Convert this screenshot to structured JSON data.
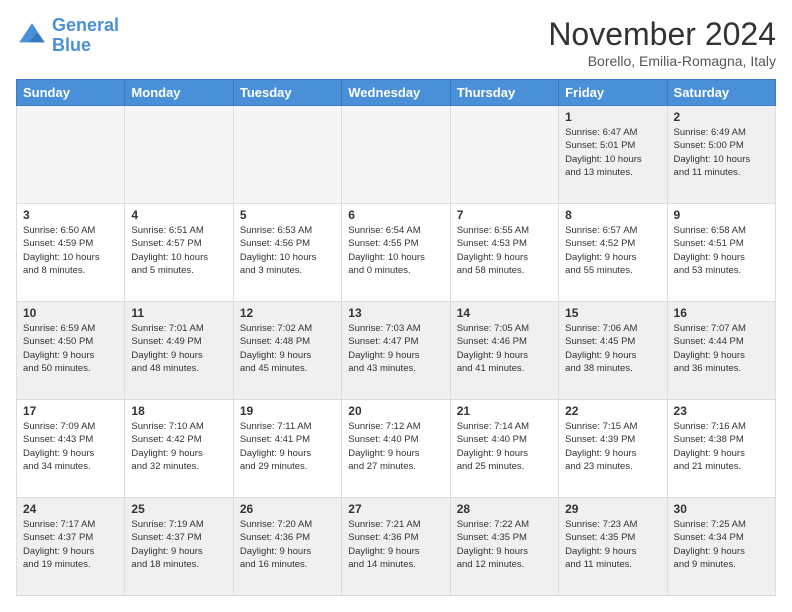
{
  "header": {
    "logo_line1": "General",
    "logo_line2": "Blue",
    "month": "November 2024",
    "location": "Borello, Emilia-Romagna, Italy"
  },
  "weekdays": [
    "Sunday",
    "Monday",
    "Tuesday",
    "Wednesday",
    "Thursday",
    "Friday",
    "Saturday"
  ],
  "weeks": [
    [
      {
        "day": "",
        "info": ""
      },
      {
        "day": "",
        "info": ""
      },
      {
        "day": "",
        "info": ""
      },
      {
        "day": "",
        "info": ""
      },
      {
        "day": "",
        "info": ""
      },
      {
        "day": "1",
        "info": "Sunrise: 6:47 AM\nSunset: 5:01 PM\nDaylight: 10 hours\nand 13 minutes."
      },
      {
        "day": "2",
        "info": "Sunrise: 6:49 AM\nSunset: 5:00 PM\nDaylight: 10 hours\nand 11 minutes."
      }
    ],
    [
      {
        "day": "3",
        "info": "Sunrise: 6:50 AM\nSunset: 4:59 PM\nDaylight: 10 hours\nand 8 minutes."
      },
      {
        "day": "4",
        "info": "Sunrise: 6:51 AM\nSunset: 4:57 PM\nDaylight: 10 hours\nand 5 minutes."
      },
      {
        "day": "5",
        "info": "Sunrise: 6:53 AM\nSunset: 4:56 PM\nDaylight: 10 hours\nand 3 minutes."
      },
      {
        "day": "6",
        "info": "Sunrise: 6:54 AM\nSunset: 4:55 PM\nDaylight: 10 hours\nand 0 minutes."
      },
      {
        "day": "7",
        "info": "Sunrise: 6:55 AM\nSunset: 4:53 PM\nDaylight: 9 hours\nand 58 minutes."
      },
      {
        "day": "8",
        "info": "Sunrise: 6:57 AM\nSunset: 4:52 PM\nDaylight: 9 hours\nand 55 minutes."
      },
      {
        "day": "9",
        "info": "Sunrise: 6:58 AM\nSunset: 4:51 PM\nDaylight: 9 hours\nand 53 minutes."
      }
    ],
    [
      {
        "day": "10",
        "info": "Sunrise: 6:59 AM\nSunset: 4:50 PM\nDaylight: 9 hours\nand 50 minutes."
      },
      {
        "day": "11",
        "info": "Sunrise: 7:01 AM\nSunset: 4:49 PM\nDaylight: 9 hours\nand 48 minutes."
      },
      {
        "day": "12",
        "info": "Sunrise: 7:02 AM\nSunset: 4:48 PM\nDaylight: 9 hours\nand 45 minutes."
      },
      {
        "day": "13",
        "info": "Sunrise: 7:03 AM\nSunset: 4:47 PM\nDaylight: 9 hours\nand 43 minutes."
      },
      {
        "day": "14",
        "info": "Sunrise: 7:05 AM\nSunset: 4:46 PM\nDaylight: 9 hours\nand 41 minutes."
      },
      {
        "day": "15",
        "info": "Sunrise: 7:06 AM\nSunset: 4:45 PM\nDaylight: 9 hours\nand 38 minutes."
      },
      {
        "day": "16",
        "info": "Sunrise: 7:07 AM\nSunset: 4:44 PM\nDaylight: 9 hours\nand 36 minutes."
      }
    ],
    [
      {
        "day": "17",
        "info": "Sunrise: 7:09 AM\nSunset: 4:43 PM\nDaylight: 9 hours\nand 34 minutes."
      },
      {
        "day": "18",
        "info": "Sunrise: 7:10 AM\nSunset: 4:42 PM\nDaylight: 9 hours\nand 32 minutes."
      },
      {
        "day": "19",
        "info": "Sunrise: 7:11 AM\nSunset: 4:41 PM\nDaylight: 9 hours\nand 29 minutes."
      },
      {
        "day": "20",
        "info": "Sunrise: 7:12 AM\nSunset: 4:40 PM\nDaylight: 9 hours\nand 27 minutes."
      },
      {
        "day": "21",
        "info": "Sunrise: 7:14 AM\nSunset: 4:40 PM\nDaylight: 9 hours\nand 25 minutes."
      },
      {
        "day": "22",
        "info": "Sunrise: 7:15 AM\nSunset: 4:39 PM\nDaylight: 9 hours\nand 23 minutes."
      },
      {
        "day": "23",
        "info": "Sunrise: 7:16 AM\nSunset: 4:38 PM\nDaylight: 9 hours\nand 21 minutes."
      }
    ],
    [
      {
        "day": "24",
        "info": "Sunrise: 7:17 AM\nSunset: 4:37 PM\nDaylight: 9 hours\nand 19 minutes."
      },
      {
        "day": "25",
        "info": "Sunrise: 7:19 AM\nSunset: 4:37 PM\nDaylight: 9 hours\nand 18 minutes."
      },
      {
        "day": "26",
        "info": "Sunrise: 7:20 AM\nSunset: 4:36 PM\nDaylight: 9 hours\nand 16 minutes."
      },
      {
        "day": "27",
        "info": "Sunrise: 7:21 AM\nSunset: 4:36 PM\nDaylight: 9 hours\nand 14 minutes."
      },
      {
        "day": "28",
        "info": "Sunrise: 7:22 AM\nSunset: 4:35 PM\nDaylight: 9 hours\nand 12 minutes."
      },
      {
        "day": "29",
        "info": "Sunrise: 7:23 AM\nSunset: 4:35 PM\nDaylight: 9 hours\nand 11 minutes."
      },
      {
        "day": "30",
        "info": "Sunrise: 7:25 AM\nSunset: 4:34 PM\nDaylight: 9 hours\nand 9 minutes."
      }
    ]
  ]
}
